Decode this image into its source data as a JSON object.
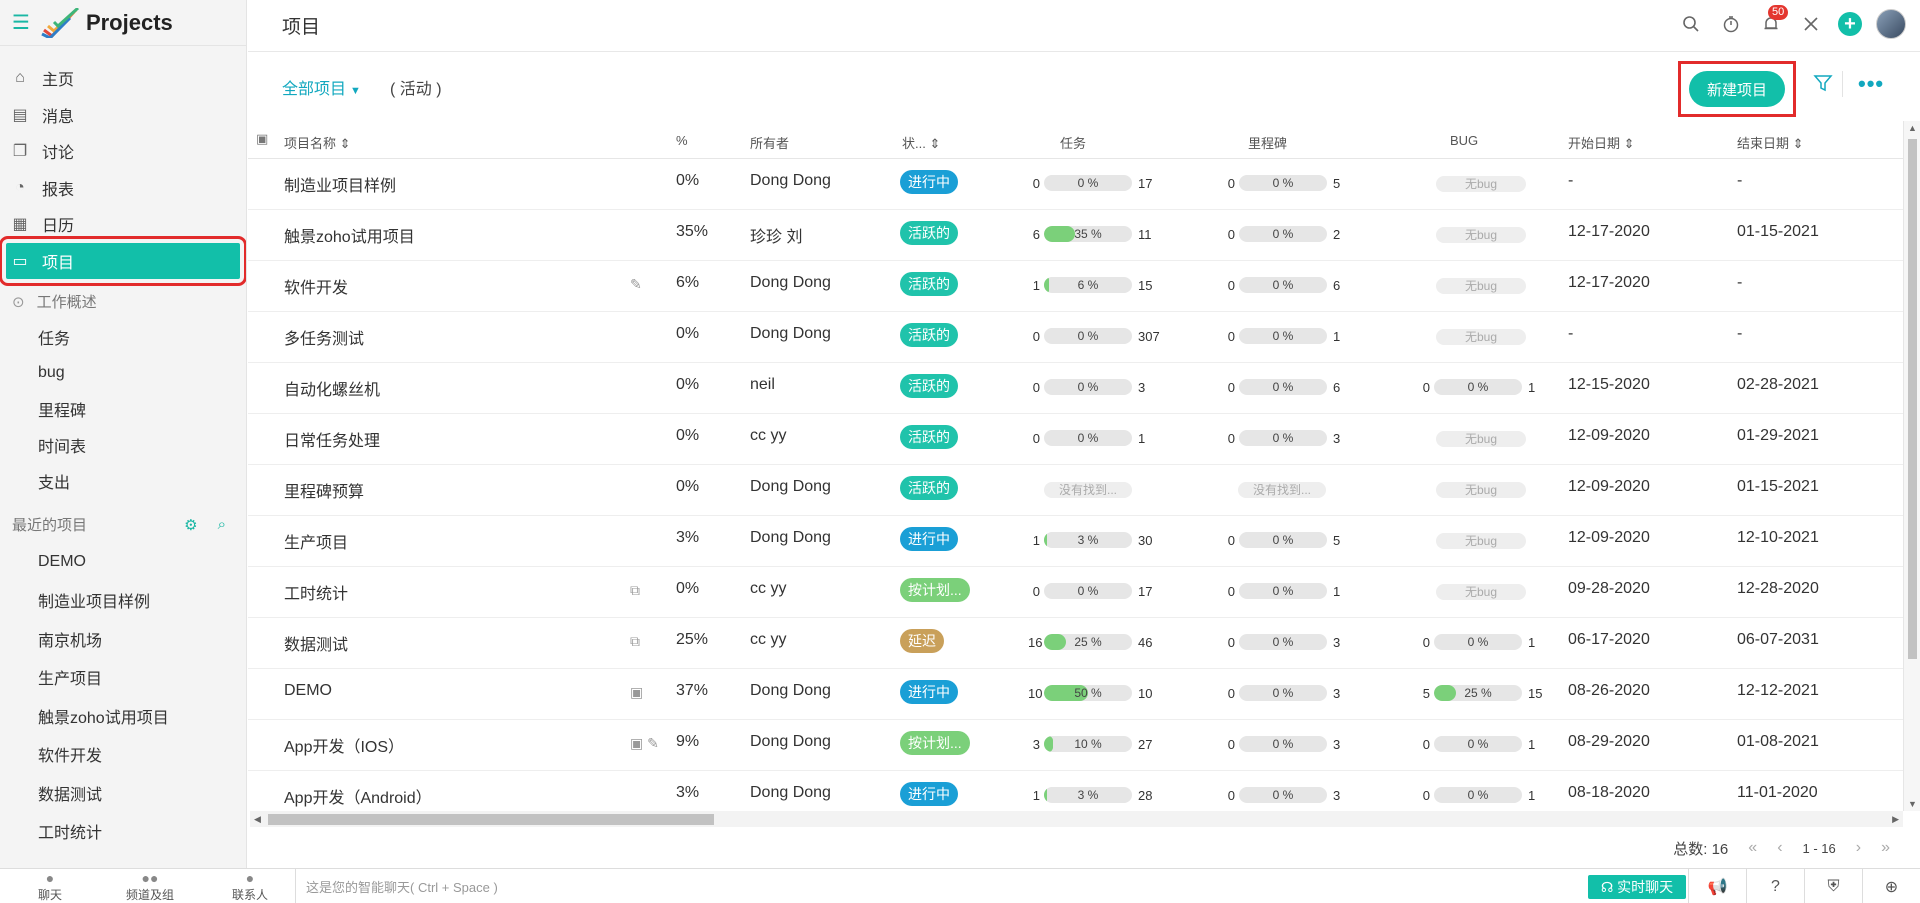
{
  "app": {
    "title": "Projects"
  },
  "nav": {
    "home": "主页",
    "messages": "消息",
    "discuss": "讨论",
    "reports": "报表",
    "calendar": "日历",
    "projects": "项目"
  },
  "overview": {
    "label": "工作概述",
    "items": [
      "任务",
      "bug",
      "里程碑",
      "时间表",
      "支出"
    ]
  },
  "recent": {
    "label": "最近的项目",
    "items": [
      "DEMO",
      "制造业项目样例",
      "南京机场",
      "生产项目",
      "触景zoho试用项目",
      "软件开发",
      "数据测试",
      "工时统计"
    ]
  },
  "header": {
    "page_title": "项目",
    "notif_count": "50",
    "all_projects": "全部项目",
    "active_filter": "( 活动 )",
    "new_project": "新建项目"
  },
  "columns": {
    "name": "项目名称",
    "pct": "%",
    "owner": "所有者",
    "status": "状...",
    "tasks": "任务",
    "milestones": "里程碑",
    "bug": "BUG",
    "start": "开始日期",
    "end": "结束日期"
  },
  "labels": {
    "not_found": "没有找到...",
    "no_bug": "无bug"
  },
  "colors": {
    "accent": "#12bfa9",
    "in_progress": "#1a9fd6",
    "active": "#20c3ab",
    "planned": "#7bd07a",
    "delayed": "#c9a05a"
  },
  "rows": [
    {
      "name": "制造业项目样例",
      "pct": "0%",
      "owner": "Dong Dong",
      "status": "进行中",
      "status_kind": "in_progress",
      "task": {
        "l": "0",
        "p": "0 %",
        "fill": 0,
        "r": "17"
      },
      "ms": {
        "l": "0",
        "p": "0 %",
        "fill": 0,
        "r": "5"
      },
      "bug": null,
      "start": "-",
      "end": "-"
    },
    {
      "name": "触景zoho试用项目",
      "pct": "35%",
      "owner": "珍珍 刘",
      "status": "活跃的",
      "status_kind": "active",
      "task": {
        "l": "6",
        "p": "35 %",
        "fill": 35,
        "r": "11"
      },
      "ms": {
        "l": "0",
        "p": "0 %",
        "fill": 0,
        "r": "2"
      },
      "bug": null,
      "start": "12-17-2020",
      "end": "01-15-2021"
    },
    {
      "name": "软件开发",
      "pct": "6%",
      "owner": "Dong Dong",
      "status": "活跃的",
      "status_kind": "active",
      "extra": "✎",
      "task": {
        "l": "1",
        "p": "6 %",
        "fill": 6,
        "r": "15"
      },
      "ms": {
        "l": "0",
        "p": "0 %",
        "fill": 0,
        "r": "6"
      },
      "bug": null,
      "start": "12-17-2020",
      "end": "-"
    },
    {
      "name": "多任务测试",
      "pct": "0%",
      "owner": "Dong Dong",
      "status": "活跃的",
      "status_kind": "active",
      "task": {
        "l": "0",
        "p": "0 %",
        "fill": 0,
        "r": "307"
      },
      "ms": {
        "l": "0",
        "p": "0 %",
        "fill": 0,
        "r": "1"
      },
      "bug": null,
      "start": "-",
      "end": "-"
    },
    {
      "name": "自动化螺丝机",
      "pct": "0%",
      "owner": "neil",
      "status": "活跃的",
      "status_kind": "active",
      "task": {
        "l": "0",
        "p": "0 %",
        "fill": 0,
        "r": "3"
      },
      "ms": {
        "l": "0",
        "p": "0 %",
        "fill": 0,
        "r": "6"
      },
      "bug": {
        "l": "0",
        "p": "0 %",
        "fill": 0,
        "r": "1"
      },
      "start": "12-15-2020",
      "end": "02-28-2021"
    },
    {
      "name": "日常任务处理",
      "pct": "0%",
      "owner": "cc yy",
      "status": "活跃的",
      "status_kind": "active",
      "task": {
        "l": "0",
        "p": "0 %",
        "fill": 0,
        "r": "1"
      },
      "ms": {
        "l": "0",
        "p": "0 %",
        "fill": 0,
        "r": "3"
      },
      "bug": null,
      "start": "12-09-2020",
      "end": "01-29-2021"
    },
    {
      "name": "里程碑预算",
      "pct": "0%",
      "owner": "Dong Dong",
      "status": "活跃的",
      "status_kind": "active",
      "task": null,
      "ms": null,
      "bug": null,
      "start": "12-09-2020",
      "end": "01-15-2021"
    },
    {
      "name": "生产项目",
      "pct": "3%",
      "owner": "Dong Dong",
      "status": "进行中",
      "status_kind": "in_progress",
      "task": {
        "l": "1",
        "p": "3 %",
        "fill": 3,
        "r": "30"
      },
      "ms": {
        "l": "0",
        "p": "0 %",
        "fill": 0,
        "r": "5"
      },
      "bug": null,
      "start": "12-09-2020",
      "end": "12-10-2021"
    },
    {
      "name": "工时统计",
      "pct": "0%",
      "owner": "cc yy",
      "status": "按计划...",
      "status_kind": "planned",
      "extra": "⧉",
      "task": {
        "l": "0",
        "p": "0 %",
        "fill": 0,
        "r": "17"
      },
      "ms": {
        "l": "0",
        "p": "0 %",
        "fill": 0,
        "r": "1"
      },
      "bug": null,
      "start": "09-28-2020",
      "end": "12-28-2020"
    },
    {
      "name": "数据测试",
      "pct": "25%",
      "owner": "cc yy",
      "status": "延迟",
      "status_kind": "delayed",
      "extra": "⧉",
      "task": {
        "l": "16",
        "p": "25 %",
        "fill": 25,
        "r": "46"
      },
      "ms": {
        "l": "0",
        "p": "0 %",
        "fill": 0,
        "r": "3"
      },
      "bug": {
        "l": "0",
        "p": "0 %",
        "fill": 0,
        "r": "1"
      },
      "start": "06-17-2020",
      "end": "06-07-2031"
    },
    {
      "name": "DEMO",
      "pct": "37%",
      "owner": "Dong Dong",
      "status": "进行中",
      "status_kind": "in_progress",
      "extra": "▣",
      "task": {
        "l": "10",
        "p": "50 %",
        "fill": 50,
        "r": "10"
      },
      "ms": {
        "l": "0",
        "p": "0 %",
        "fill": 0,
        "r": "3"
      },
      "bug": {
        "l": "5",
        "p": "25 %",
        "fill": 25,
        "r": "15"
      },
      "start": "08-26-2020",
      "end": "12-12-2021"
    },
    {
      "name": "App开发（IOS）",
      "pct": "9%",
      "owner": "Dong Dong",
      "status": "按计划...",
      "status_kind": "planned",
      "extra": "▣ ✎",
      "task": {
        "l": "3",
        "p": "10 %",
        "fill": 10,
        "r": "27"
      },
      "ms": {
        "l": "0",
        "p": "0 %",
        "fill": 0,
        "r": "3"
      },
      "bug": {
        "l": "0",
        "p": "0 %",
        "fill": 0,
        "r": "1"
      },
      "start": "08-29-2020",
      "end": "01-08-2021"
    },
    {
      "name": "App开发（Android）",
      "pct": "3%",
      "owner": "Dong Dong",
      "status": "进行中",
      "status_kind": "in_progress",
      "task": {
        "l": "1",
        "p": "3 %",
        "fill": 3,
        "r": "28"
      },
      "ms": {
        "l": "0",
        "p": "0 %",
        "fill": 0,
        "r": "3"
      },
      "bug": {
        "l": "0",
        "p": "0 %",
        "fill": 0,
        "r": "1"
      },
      "start": "08-18-2020",
      "end": "11-01-2020"
    }
  ],
  "pager": {
    "total": "总数: 16",
    "range": "1 - 16"
  },
  "bottom": {
    "chat": "聊天",
    "channels": "频道及组",
    "contacts": "联系人",
    "chat_placeholder": "这是您的智能聊天( Ctrl + Space )",
    "live_chat": "实时聊天"
  }
}
